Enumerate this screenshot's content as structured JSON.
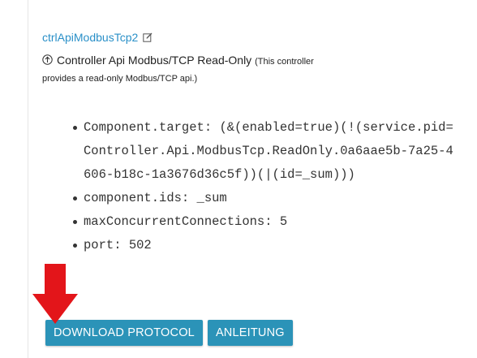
{
  "component": {
    "id": "ctrlApiModbusTcp2",
    "name": "Controller Api Modbus/TCP Read-Only",
    "description_part1": "(This controller",
    "description_part2": "provides a read-only Modbus/TCP api.)"
  },
  "properties": [
    {
      "key": "Component.target",
      "value": "(&(enabled=true)(!(service.pid=Controller.Api.ModbusTcp.ReadOnly.0a6aae5b-7a25-4606-b18c-1a3676d36c5f))(|(id=_sum)))"
    },
    {
      "key": "component.ids",
      "value": "_sum"
    },
    {
      "key": "maxConcurrentConnections",
      "value": "5"
    },
    {
      "key": "port",
      "value": "502"
    }
  ],
  "buttons": {
    "download": "DOWNLOAD PROTOCOL",
    "manual": "ANLEITUNG"
  },
  "colors": {
    "link": "#2a90c8",
    "button": "#2b93b8",
    "arrow": "#e3151a"
  },
  "icons": {
    "edit": "edit-icon",
    "arrow_up": "arrow-circle-up-icon",
    "pointer": "red-arrow-down-icon"
  }
}
